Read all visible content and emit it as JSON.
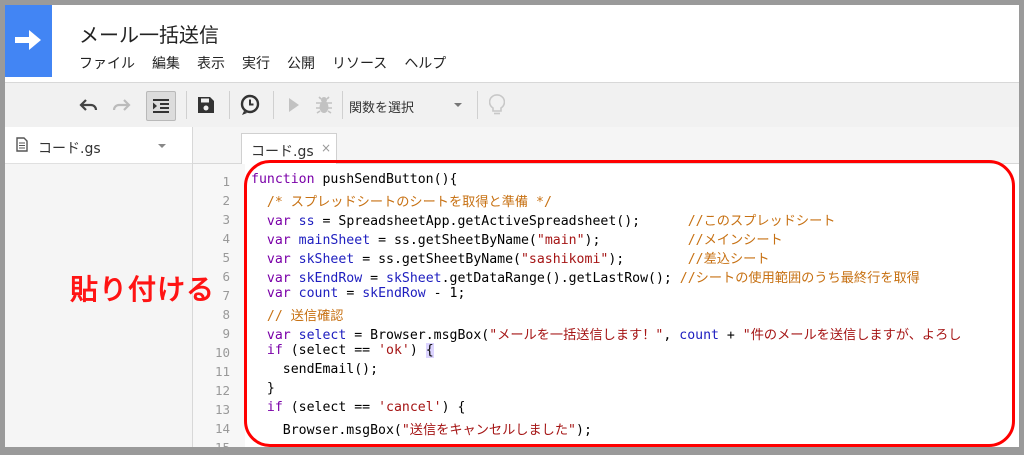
{
  "app": {
    "title": "メール一括送信",
    "menu": [
      "ファイル",
      "編集",
      "表示",
      "実行",
      "公開",
      "リソース",
      "ヘルプ"
    ],
    "accent_color": "#4285f4"
  },
  "toolbar": {
    "icons": [
      "undo-icon",
      "redo-icon",
      "indent-icon",
      "save-icon",
      "triggers-clock-icon",
      "run-icon",
      "debug-bug-icon",
      "lightbulb-icon"
    ],
    "function_select_label": "関数を選択"
  },
  "sidebar": {
    "file_name": "コード.gs"
  },
  "editor": {
    "tab_label": "コード.gs",
    "tab_close": "×",
    "line_numbers": [
      "1",
      "2",
      "3",
      "4",
      "5",
      "6",
      "7",
      "8",
      "9",
      "10",
      "11",
      "12",
      "13",
      "14",
      "15"
    ]
  },
  "code_lines": [
    [
      {
        "t": "function",
        "c": "kw"
      },
      {
        "t": " pushSendButton(){"
      }
    ],
    [
      {
        "t": "  "
      },
      {
        "t": "/* スプレッドシートのシートを取得と準備 */",
        "c": "cm"
      }
    ],
    [
      {
        "t": "  "
      },
      {
        "t": "var",
        "c": "kw"
      },
      {
        "t": " "
      },
      {
        "t": "ss",
        "c": "vr"
      },
      {
        "t": " = SpreadsheetApp.getActiveSpreadsheet();      "
      },
      {
        "t": "//このスプレッドシート",
        "c": "cm"
      }
    ],
    [
      {
        "t": "  "
      },
      {
        "t": "var",
        "c": "kw"
      },
      {
        "t": " "
      },
      {
        "t": "mainSheet",
        "c": "vr"
      },
      {
        "t": " = ss.getSheetByName("
      },
      {
        "t": "\"main\"",
        "c": "st"
      },
      {
        "t": ");           "
      },
      {
        "t": "//メインシート",
        "c": "cm"
      }
    ],
    [
      {
        "t": "  "
      },
      {
        "t": "var",
        "c": "kw"
      },
      {
        "t": " "
      },
      {
        "t": "skSheet",
        "c": "vr"
      },
      {
        "t": " = ss.getSheetByName("
      },
      {
        "t": "\"sashikomi\"",
        "c": "st"
      },
      {
        "t": ");        "
      },
      {
        "t": "//差込シート",
        "c": "cm"
      }
    ],
    [
      {
        "t": "  "
      },
      {
        "t": "var",
        "c": "kw"
      },
      {
        "t": " "
      },
      {
        "t": "skEndRow",
        "c": "vr"
      },
      {
        "t": " = "
      },
      {
        "t": "skSheet",
        "c": "vr"
      },
      {
        "t": ".getDataRange().getLastRow(); "
      },
      {
        "t": "//シートの使用範囲のうち最終行を取得",
        "c": "cm"
      }
    ],
    [
      {
        "t": "  "
      },
      {
        "t": "var",
        "c": "kw"
      },
      {
        "t": " "
      },
      {
        "t": "count",
        "c": "vr"
      },
      {
        "t": " = "
      },
      {
        "t": "skEndRow",
        "c": "vr"
      },
      {
        "t": " - 1;"
      }
    ],
    [
      {
        "t": "  "
      },
      {
        "t": "// 送信確認",
        "c": "cm"
      }
    ],
    [
      {
        "t": "  "
      },
      {
        "t": "var",
        "c": "kw"
      },
      {
        "t": " "
      },
      {
        "t": "select",
        "c": "vr"
      },
      {
        "t": " = Browser.msgBox("
      },
      {
        "t": "\"メールを一括送信します！\"",
        "c": "st"
      },
      {
        "t": ", "
      },
      {
        "t": "count",
        "c": "vr"
      },
      {
        "t": " + "
      },
      {
        "t": "\"件のメールを送信しますが、よろし",
        "c": "st"
      }
    ],
    [
      {
        "t": "  "
      },
      {
        "t": "if",
        "c": "kw"
      },
      {
        "t": " (select == "
      },
      {
        "t": "'ok'",
        "c": "st"
      },
      {
        "t": ") "
      },
      {
        "t": "{",
        "c": "hl"
      }
    ],
    [
      {
        "t": "    sendEmail();"
      }
    ],
    [
      {
        "t": "  }"
      }
    ],
    [
      {
        "t": "  "
      },
      {
        "t": "if",
        "c": "kw"
      },
      {
        "t": " (select == "
      },
      {
        "t": "'cancel'",
        "c": "st"
      },
      {
        "t": ") {"
      }
    ],
    [
      {
        "t": "    Browser.msgBox("
      },
      {
        "t": "\"送信をキャンセルしました\"",
        "c": "st"
      },
      {
        "t": ");"
      }
    ],
    [
      {
        "t": ""
      }
    ]
  ],
  "annotation": {
    "callout_text": "貼り付ける",
    "highlight_color": "#ff0000"
  }
}
